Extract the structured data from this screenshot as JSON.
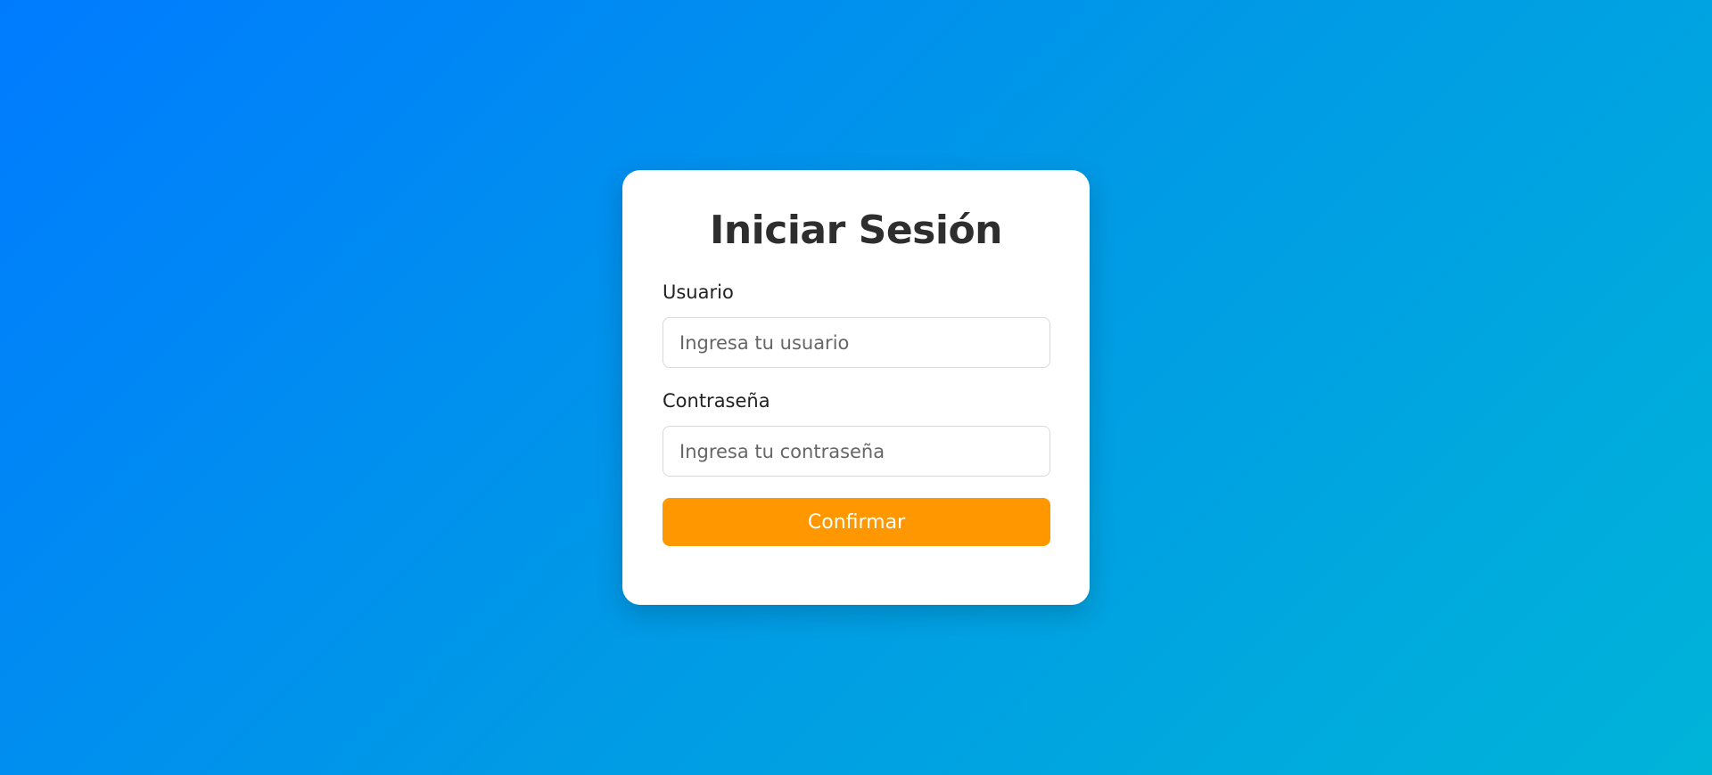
{
  "colors": {
    "background_gradient_start": "#007bff",
    "background_gradient_end": "#00b4d8",
    "card_background": "#ffffff",
    "title_color": "#2e2e2e",
    "button_color": "#ff9800",
    "button_text_color": "#ffffff"
  },
  "login_form": {
    "title": "Iniciar Sesión",
    "username": {
      "label": "Usuario",
      "value": "",
      "placeholder": "Ingresa tu usuario"
    },
    "password": {
      "label": "Contraseña",
      "value": "",
      "placeholder": "Ingresa tu contraseña"
    },
    "submit_label": "Confirmar"
  }
}
